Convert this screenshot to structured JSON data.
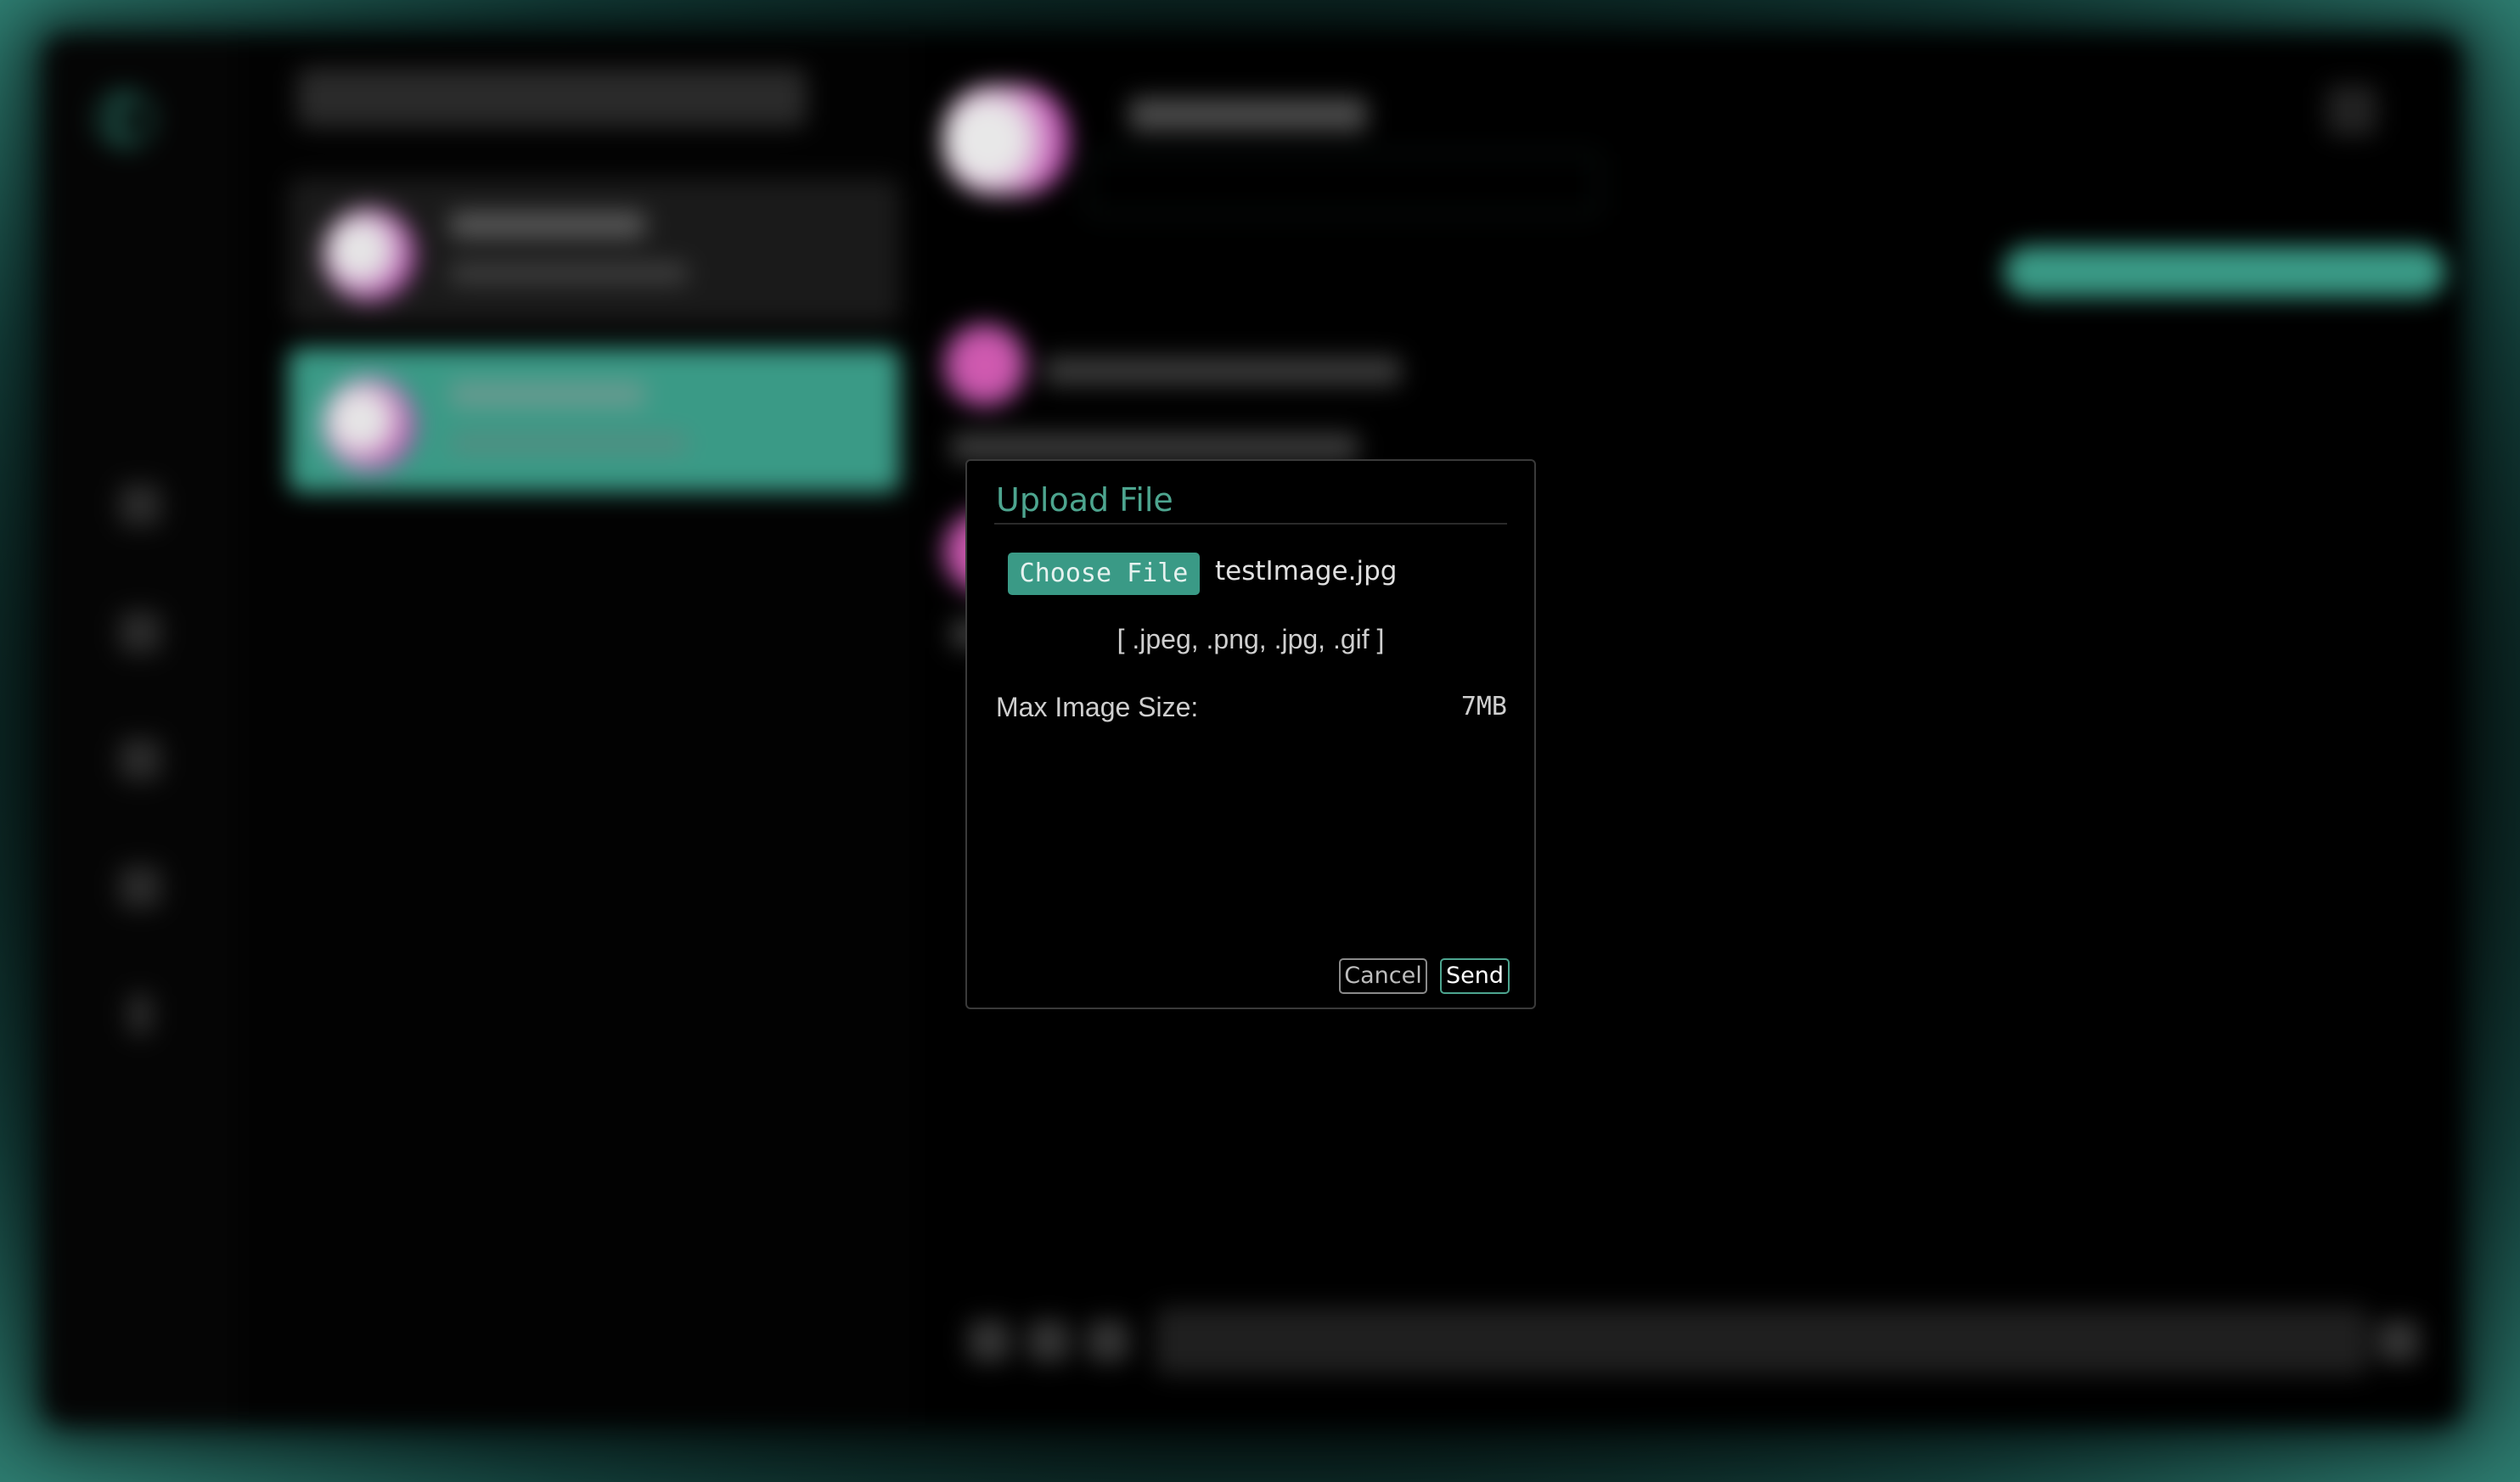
{
  "colors": {
    "accent": "#3a9a86",
    "accent_text": "#4da58f",
    "background": "#000000"
  },
  "dialog": {
    "title": "Upload File",
    "choose_file_label": "Choose File",
    "selected_file": "testImage.jpg",
    "accepted_formats": "[ .jpeg, .png, .jpg, .gif ]",
    "max_size_label": "Max Image Size:",
    "max_size_value": "7MB",
    "cancel_label": "Cancel",
    "send_label": "Send"
  }
}
